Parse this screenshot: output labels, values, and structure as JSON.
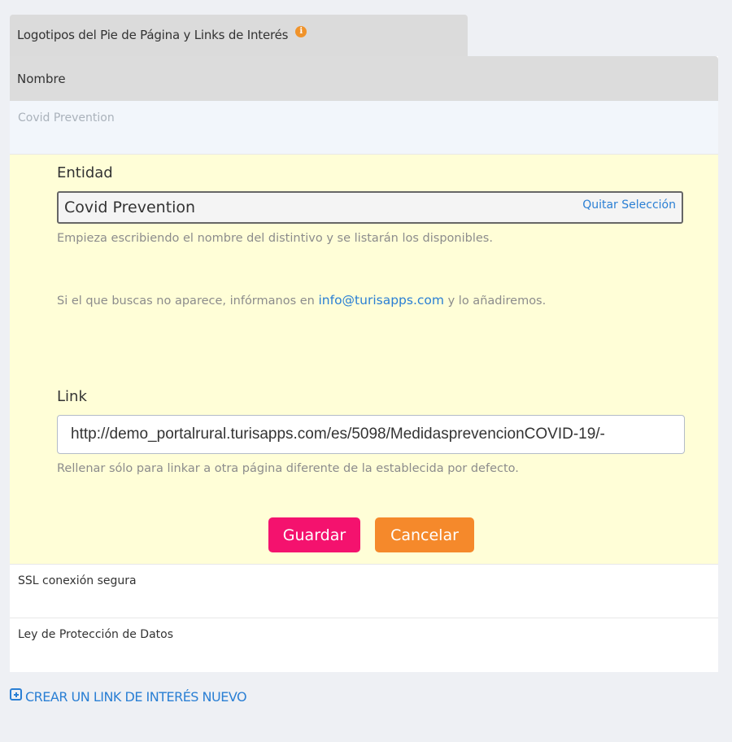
{
  "section": {
    "title": "Logotipos del Pie de Página y Links de Interés",
    "info_icon": "i"
  },
  "table": {
    "column_header": "Nombre",
    "selected_row": "Covid Prevention",
    "rows": [
      {
        "name": "SSL conexión segura"
      },
      {
        "name": "Ley de Protección de Datos"
      }
    ]
  },
  "editor": {
    "entity_label": "Entidad",
    "entity_value": "Covid Prevention",
    "clear_selection": "Quitar Selección",
    "entity_help": "Empieza escribiendo el nombre del distintivo y se listarán los disponibles.",
    "contact_before": "Si el que buscas no aparece, infórmanos en",
    "contact_email": "info@turisapps.com",
    "contact_after": "y lo añadiremos.",
    "link_label": "Link",
    "link_value": "http://demo_portalrural.turisapps.com/es/5098/MedidasprevencionCOVID-19/-",
    "link_help": "Rellenar sólo para linkar a otra página diferente de la establecida por defecto.",
    "save_label": "Guardar",
    "cancel_label": "Cancelar"
  },
  "create_link": {
    "label": "CREAR UN LINK DE INTERÉS NUEVO"
  },
  "colors": {
    "accent_blue": "#2a7fd4",
    "save_pink": "#f4126e",
    "cancel_orange": "#f5892b",
    "edit_background": "#fffed7",
    "info_orange": "#f0932b"
  }
}
